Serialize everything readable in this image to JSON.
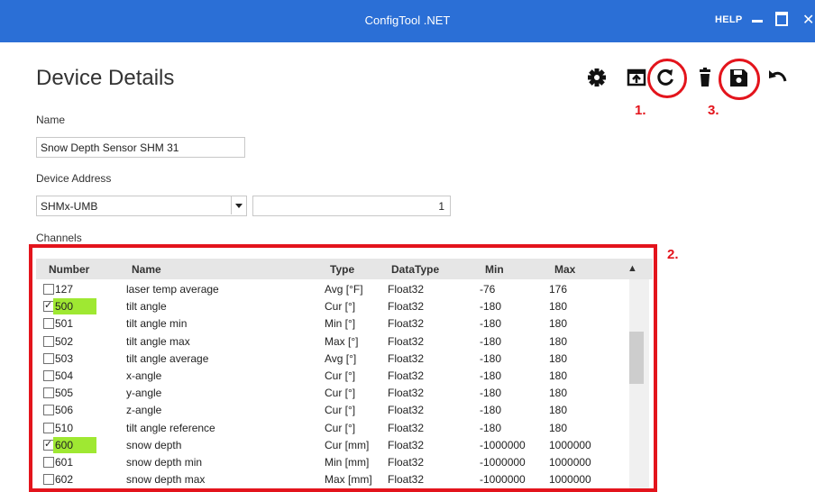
{
  "window": {
    "title": "ConfigTool .NET",
    "help": "HELP"
  },
  "page": {
    "heading": "Device Details"
  },
  "form": {
    "name_label": "Name",
    "name_value": "Snow Depth Sensor SHM 31",
    "address_label": "Device Address",
    "address_protocol": "SHMx-UMB",
    "address_value": "1",
    "channels_label": "Channels"
  },
  "toolbar": {
    "icons": [
      "gear-icon",
      "upload-icon",
      "refresh-icon",
      "delete-icon",
      "save-icon",
      "undo-icon"
    ]
  },
  "annotations": {
    "one": "1.",
    "two": "2.",
    "three": "3.",
    "color": "#e3141c"
  },
  "channels": {
    "columns": [
      "Number",
      "Name",
      "Type",
      "DataType",
      "Min",
      "Max"
    ],
    "rows": [
      {
        "checked": false,
        "highlight": false,
        "number": "127",
        "name": "laser temp average",
        "type": "Avg [°F]",
        "datatype": "Float32",
        "min": "-76",
        "max": "176"
      },
      {
        "checked": true,
        "highlight": true,
        "number": "500",
        "name": "tilt angle",
        "type": "Cur [°]",
        "datatype": "Float32",
        "min": "-180",
        "max": "180"
      },
      {
        "checked": false,
        "highlight": false,
        "number": "501",
        "name": "tilt angle min",
        "type": "Min [°]",
        "datatype": "Float32",
        "min": "-180",
        "max": "180"
      },
      {
        "checked": false,
        "highlight": false,
        "number": "502",
        "name": "tilt angle max",
        "type": "Max [°]",
        "datatype": "Float32",
        "min": "-180",
        "max": "180"
      },
      {
        "checked": false,
        "highlight": false,
        "number": "503",
        "name": "tilt angle average",
        "type": "Avg [°]",
        "datatype": "Float32",
        "min": "-180",
        "max": "180"
      },
      {
        "checked": false,
        "highlight": false,
        "number": "504",
        "name": "x-angle",
        "type": "Cur [°]",
        "datatype": "Float32",
        "min": "-180",
        "max": "180"
      },
      {
        "checked": false,
        "highlight": false,
        "number": "505",
        "name": "y-angle",
        "type": "Cur [°]",
        "datatype": "Float32",
        "min": "-180",
        "max": "180"
      },
      {
        "checked": false,
        "highlight": false,
        "number": "506",
        "name": "z-angle",
        "type": "Cur [°]",
        "datatype": "Float32",
        "min": "-180",
        "max": "180"
      },
      {
        "checked": false,
        "highlight": false,
        "number": "510",
        "name": "tilt angle reference",
        "type": "Cur [°]",
        "datatype": "Float32",
        "min": "-180",
        "max": "180"
      },
      {
        "checked": true,
        "highlight": true,
        "number": "600",
        "name": "snow depth",
        "type": "Cur [mm]",
        "datatype": "Float32",
        "min": "-1000000",
        "max": "1000000"
      },
      {
        "checked": false,
        "highlight": false,
        "number": "601",
        "name": "snow depth min",
        "type": "Min [mm]",
        "datatype": "Float32",
        "min": "-1000000",
        "max": "1000000"
      },
      {
        "checked": false,
        "highlight": false,
        "number": "602",
        "name": "snow depth max",
        "type": "Max [mm]",
        "datatype": "Float32",
        "min": "-1000000",
        "max": "1000000"
      }
    ]
  },
  "colors": {
    "titlebar": "#2b6fd6",
    "highlight": "#9fe832",
    "accent_red": "#e3141c"
  }
}
